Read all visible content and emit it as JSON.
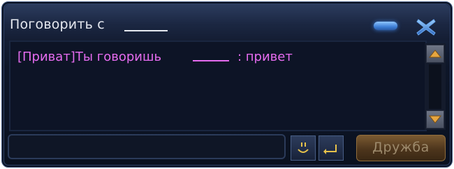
{
  "window": {
    "title": "Поговорить с"
  },
  "chat": {
    "message_prefix": "[Приват]Ты говоришь",
    "message_suffix": ": привет"
  },
  "composer": {
    "input_value": "",
    "input_placeholder": ""
  },
  "actions": {
    "friend_label": "Дружба"
  },
  "icons": {
    "minimize": "minimize-icon",
    "close": "close-icon",
    "scroll_up": "arrow-up-icon",
    "scroll_down": "arrow-down-icon",
    "emoji": "smiley-icon",
    "send": "enter-icon"
  },
  "colors": {
    "message": "#e66cf0",
    "accent": "#3f80d8"
  }
}
